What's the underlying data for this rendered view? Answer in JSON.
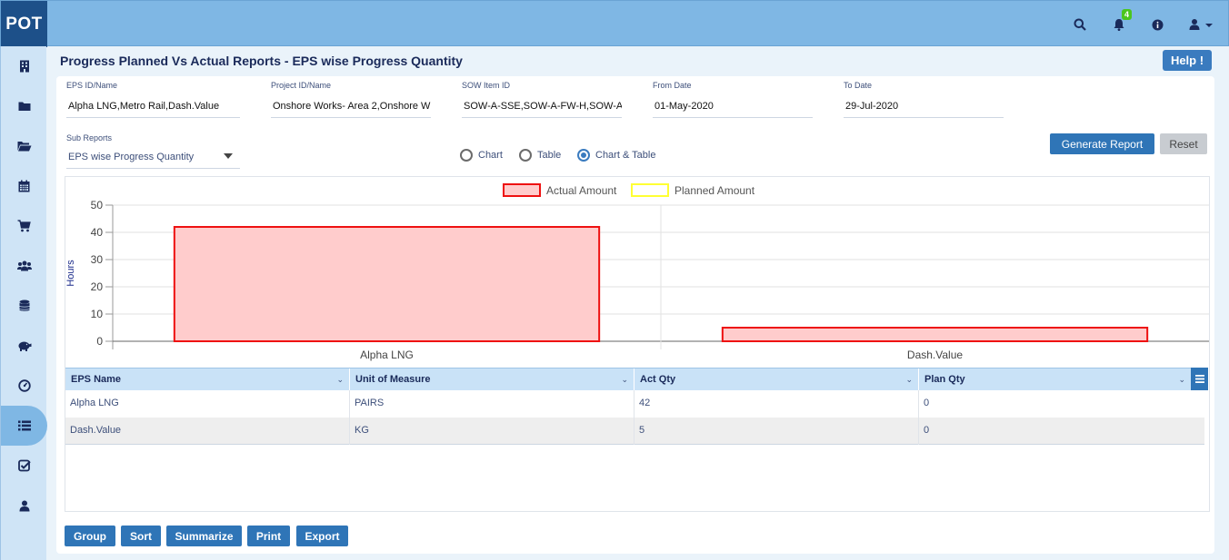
{
  "app": {
    "logo": "POT",
    "notification_count": "4"
  },
  "header_icons": [
    "search-icon",
    "bell-icon",
    "info-icon",
    "user-icon"
  ],
  "sidebar": {
    "items": [
      {
        "icon": "building-icon"
      },
      {
        "icon": "folder-icon"
      },
      {
        "icon": "folder-open-icon"
      },
      {
        "icon": "calendar-icon"
      },
      {
        "icon": "cart-icon"
      },
      {
        "icon": "users-icon"
      },
      {
        "icon": "database-icon"
      },
      {
        "icon": "piggy-bank-icon"
      },
      {
        "icon": "dashboard-icon"
      },
      {
        "icon": "list-icon",
        "active": true
      },
      {
        "icon": "checklist-icon"
      },
      {
        "icon": "user-icon"
      }
    ]
  },
  "page": {
    "title": "Progress Planned Vs Actual Reports - EPS wise Progress Quantity",
    "help_label": "Help !"
  },
  "filters": {
    "eps": {
      "label": "EPS ID/Name",
      "value": "Alpha LNG,Metro Rail,Dash.Value"
    },
    "project": {
      "label": "Project ID/Name",
      "value": "Onshore  Works- Area 2,Onshore  W"
    },
    "sow": {
      "label": "SOW Item ID",
      "value": "SOW-A-SSE,SOW-A-FW-H,SOW-A-RF"
    },
    "from_date": {
      "label": "From Date",
      "value": "01-May-2020"
    },
    "to_date": {
      "label": "To Date",
      "value": "29-Jul-2020"
    },
    "sub_reports": {
      "label": "Sub Reports",
      "value": "EPS wise Progress Quantity"
    }
  },
  "view_options": [
    {
      "label": "Chart",
      "selected": false
    },
    {
      "label": "Table",
      "selected": false
    },
    {
      "label": "Chart & Table",
      "selected": true
    }
  ],
  "actions": {
    "generate": "Generate Report",
    "reset": "Reset"
  },
  "chart_data": {
    "type": "bar",
    "categories": [
      "Alpha LNG",
      "Dash.Value"
    ],
    "series": [
      {
        "name": "Actual Amount",
        "values": [
          42,
          5
        ],
        "fill": "#ffcccc",
        "stroke": "#ee1111"
      },
      {
        "name": "Planned Amount",
        "values": [
          0,
          0
        ],
        "fill": "#ffffff",
        "stroke": "#ffff33"
      }
    ],
    "ylabel": "Hours",
    "ylim": [
      0,
      50
    ],
    "yticks": [
      0,
      10,
      20,
      30,
      40,
      50
    ],
    "grid": true,
    "legend": "top-center"
  },
  "table": {
    "columns": [
      "EPS Name",
      "Unit of Measure",
      "Act Qty",
      "Plan Qty"
    ],
    "rows": [
      [
        "Alpha LNG",
        "PAIRS",
        "42",
        "0"
      ],
      [
        "Dash.Value",
        "KG",
        "5",
        "0"
      ]
    ]
  },
  "bottom_actions": [
    "Group",
    "Sort",
    "Summarize",
    "Print",
    "Export"
  ]
}
